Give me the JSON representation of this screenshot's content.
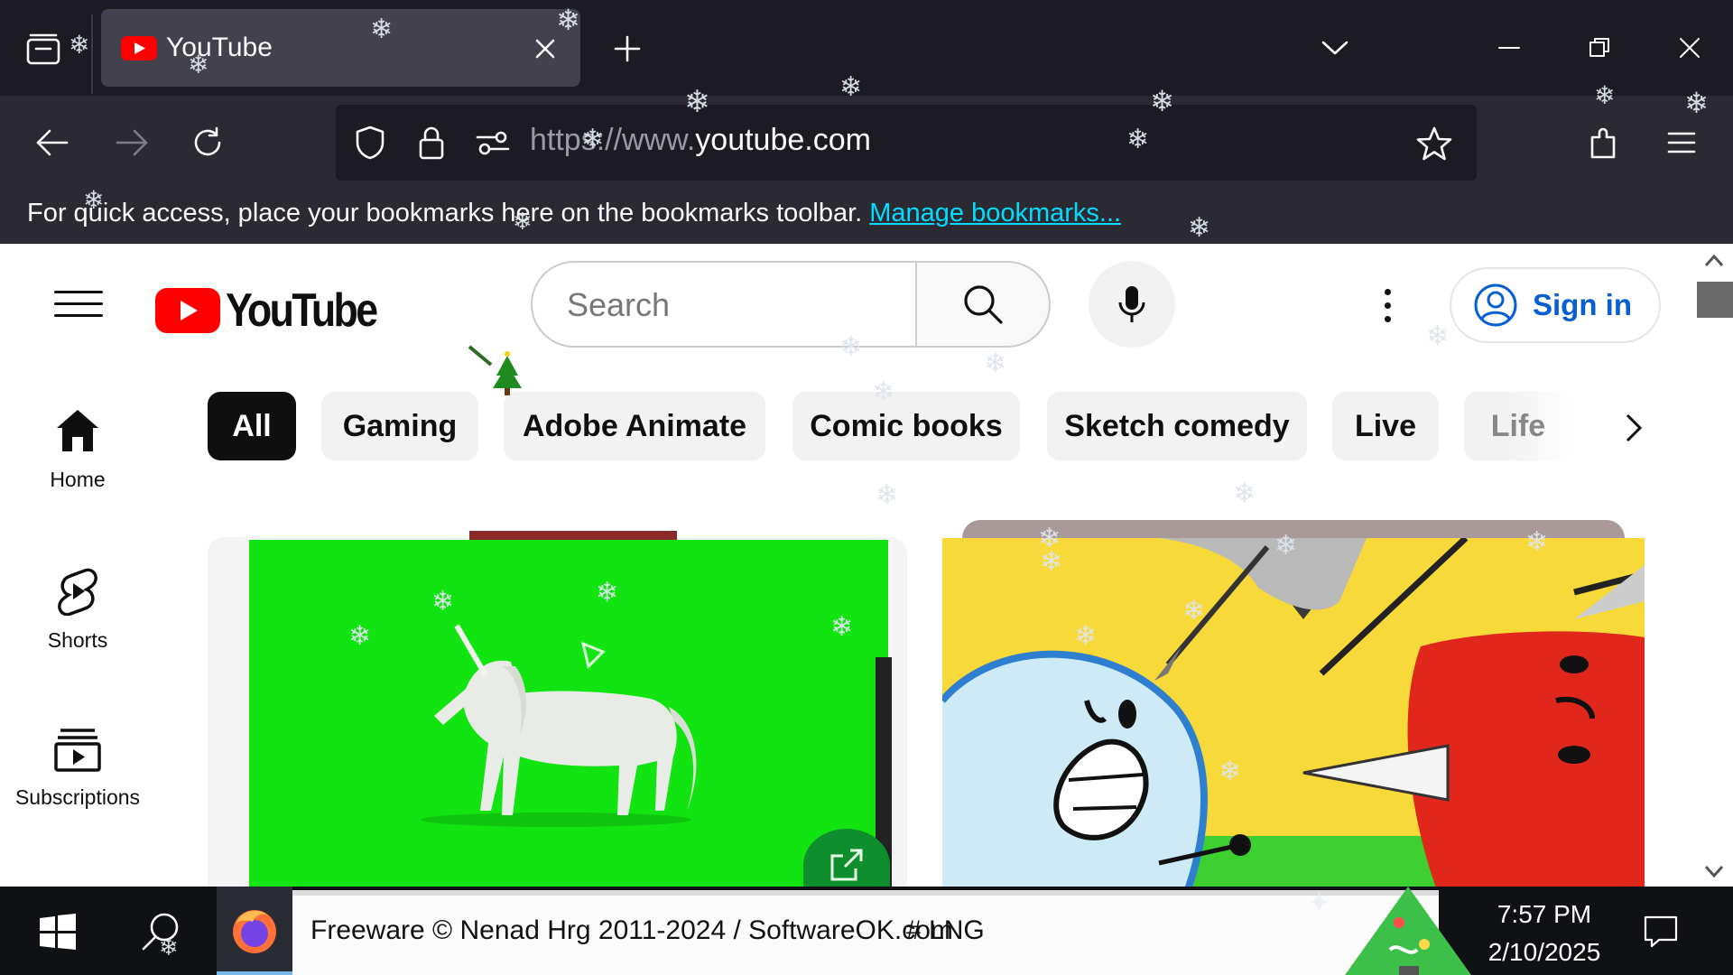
{
  "browser": {
    "tab": {
      "title": "YouTube"
    },
    "url": {
      "scheme_dim": "https://www.",
      "host": "youtube.com"
    },
    "bookmarks_bar": {
      "message": "For quick access, place your bookmarks here on the bookmarks toolbar.",
      "link": "Manage bookmarks..."
    }
  },
  "youtube": {
    "logo_text": "YouTube",
    "search": {
      "placeholder": "Search"
    },
    "sign_in": "Sign in",
    "chips": [
      "All",
      "Gaming",
      "Adobe Animate",
      "Comic books",
      "Sketch comedy",
      "Live",
      "Life"
    ],
    "guide": [
      {
        "label": "Home",
        "icon": "home-icon"
      },
      {
        "label": "Shorts",
        "icon": "shorts-icon"
      },
      {
        "label": "Subscriptions",
        "icon": "subscriptions-icon"
      }
    ]
  },
  "taskbar": {
    "ticker": "Freeware © Nenad Hrg 2011-2024 / SoftwareOK.com",
    "ticker_tag": "# LNG",
    "time": "7:57 PM",
    "date": "2/10/2025"
  },
  "colors": {
    "chrome_dark": "#1c1b22",
    "chrome_mid": "#2b2a33",
    "youtube_red": "#ff0000",
    "link_blue": "#065fd4",
    "green_screen": "#11e411"
  }
}
